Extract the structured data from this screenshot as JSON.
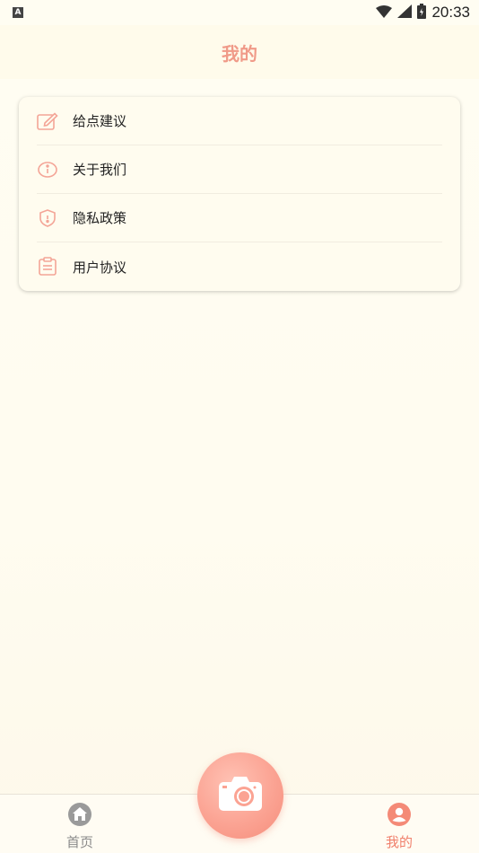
{
  "status_bar": {
    "notification_badge": "A",
    "time": "20:33"
  },
  "header": {
    "title": "我的"
  },
  "menu": {
    "items": [
      {
        "label": "给点建议",
        "icon": "edit-icon"
      },
      {
        "label": "关于我们",
        "icon": "info-icon"
      },
      {
        "label": "隐私政策",
        "icon": "shield-icon"
      },
      {
        "label": "用户协议",
        "icon": "clipboard-icon"
      }
    ]
  },
  "tabbar": {
    "home_label": "首页",
    "mine_label": "我的",
    "active_tab": "mine"
  },
  "colors": {
    "accent": "#f09a88",
    "active_tab": "#f0806c",
    "inactive_tab": "#8a8a8a",
    "background": "#fffcf0"
  }
}
